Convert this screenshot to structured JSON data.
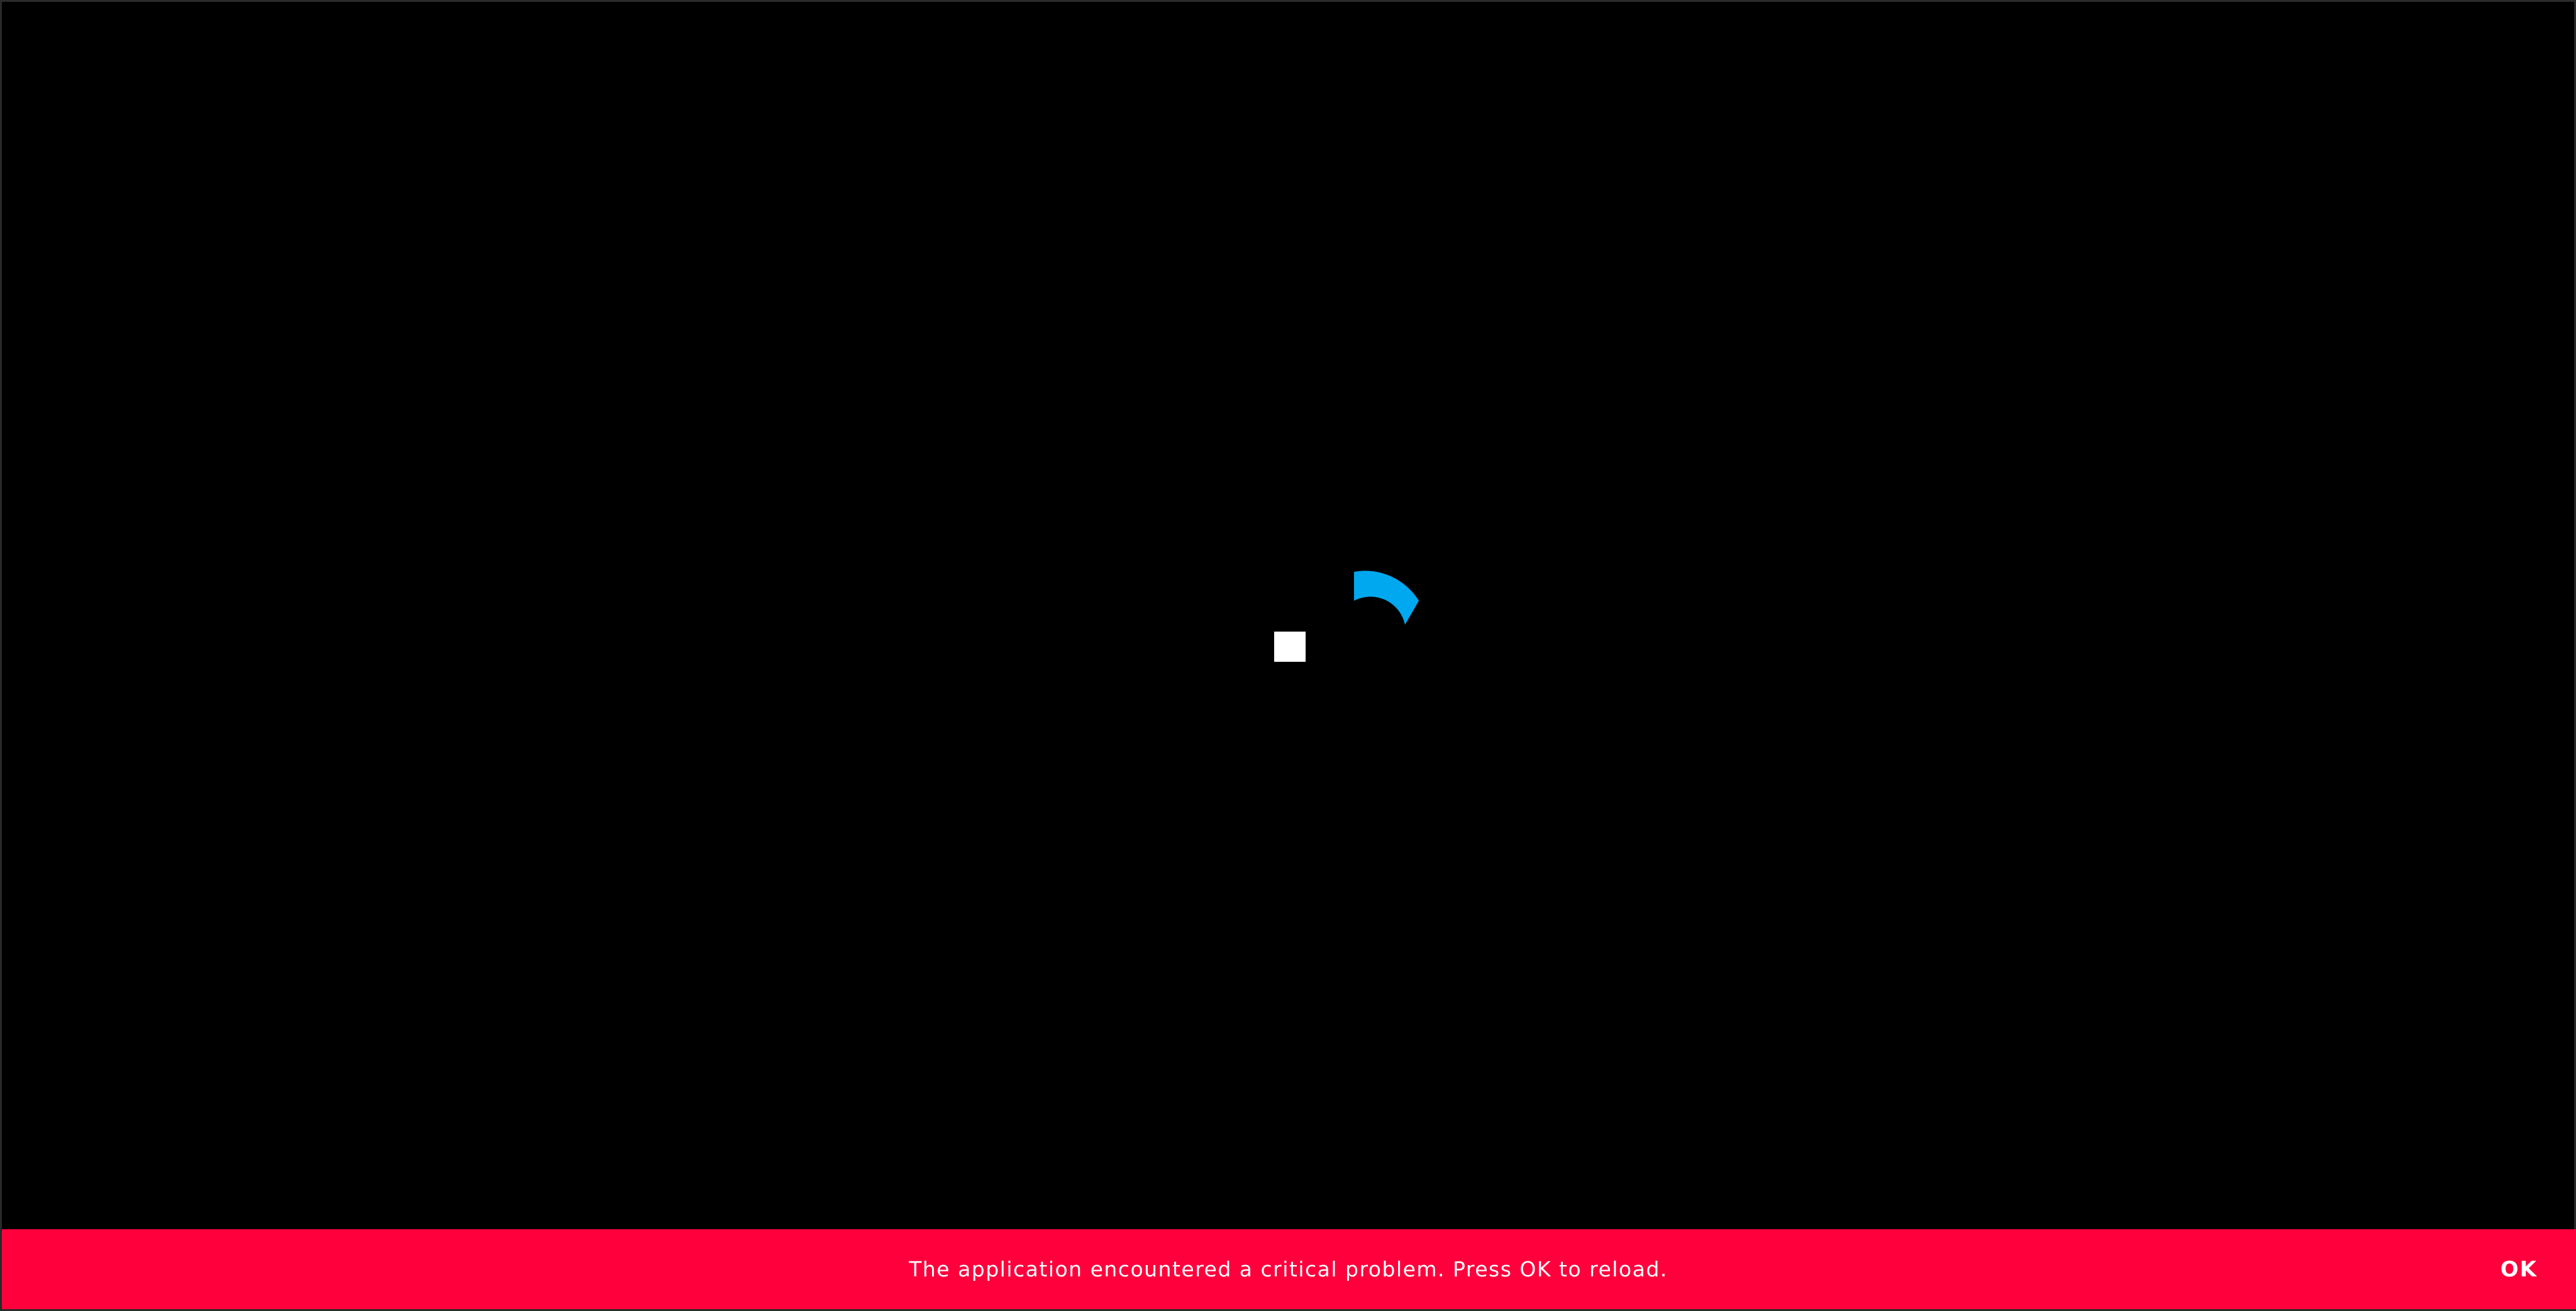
{
  "app": {
    "background_color": "#000000"
  },
  "loader": {
    "square_color": "#ffffff",
    "arc_color": "#00a8f0",
    "arc_icon": "loading-spinner-arc"
  },
  "error_banner": {
    "message": "The application encountered a critical problem. Press OK to reload.",
    "ok_label": "OK",
    "background_color": "#ff003c",
    "text_color": "#ffffff"
  }
}
